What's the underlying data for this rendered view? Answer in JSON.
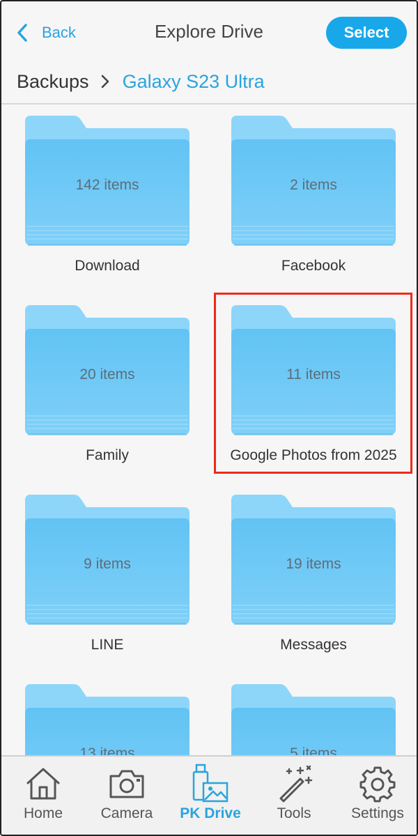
{
  "header": {
    "back_label": "Back",
    "title": "Explore Drive",
    "select_label": "Select"
  },
  "breadcrumb": {
    "root": "Backups",
    "current": "Galaxy S23 Ultra"
  },
  "folders": [
    {
      "name": "Download",
      "count": "142 items"
    },
    {
      "name": "Facebook",
      "count": "2 items"
    },
    {
      "name": "Family",
      "count": "20 items"
    },
    {
      "name": "Google Photos from 2025",
      "count": "11 items"
    },
    {
      "name": "LINE",
      "count": "9 items"
    },
    {
      "name": "Messages",
      "count": "19 items"
    },
    {
      "name": "",
      "count": "13 items"
    },
    {
      "name": "",
      "count": "5 items"
    }
  ],
  "nav": {
    "home": "Home",
    "camera": "Camera",
    "pkdrive": "PK Drive",
    "tools": "Tools",
    "settings": "Settings",
    "active": "pkdrive"
  },
  "colors": {
    "accent": "#2aa3df",
    "select_button": "#18a8ea",
    "folder_front": "#6cc8f5",
    "folder_back": "#8dd6fa",
    "highlight_box": "#ee2a1a"
  }
}
